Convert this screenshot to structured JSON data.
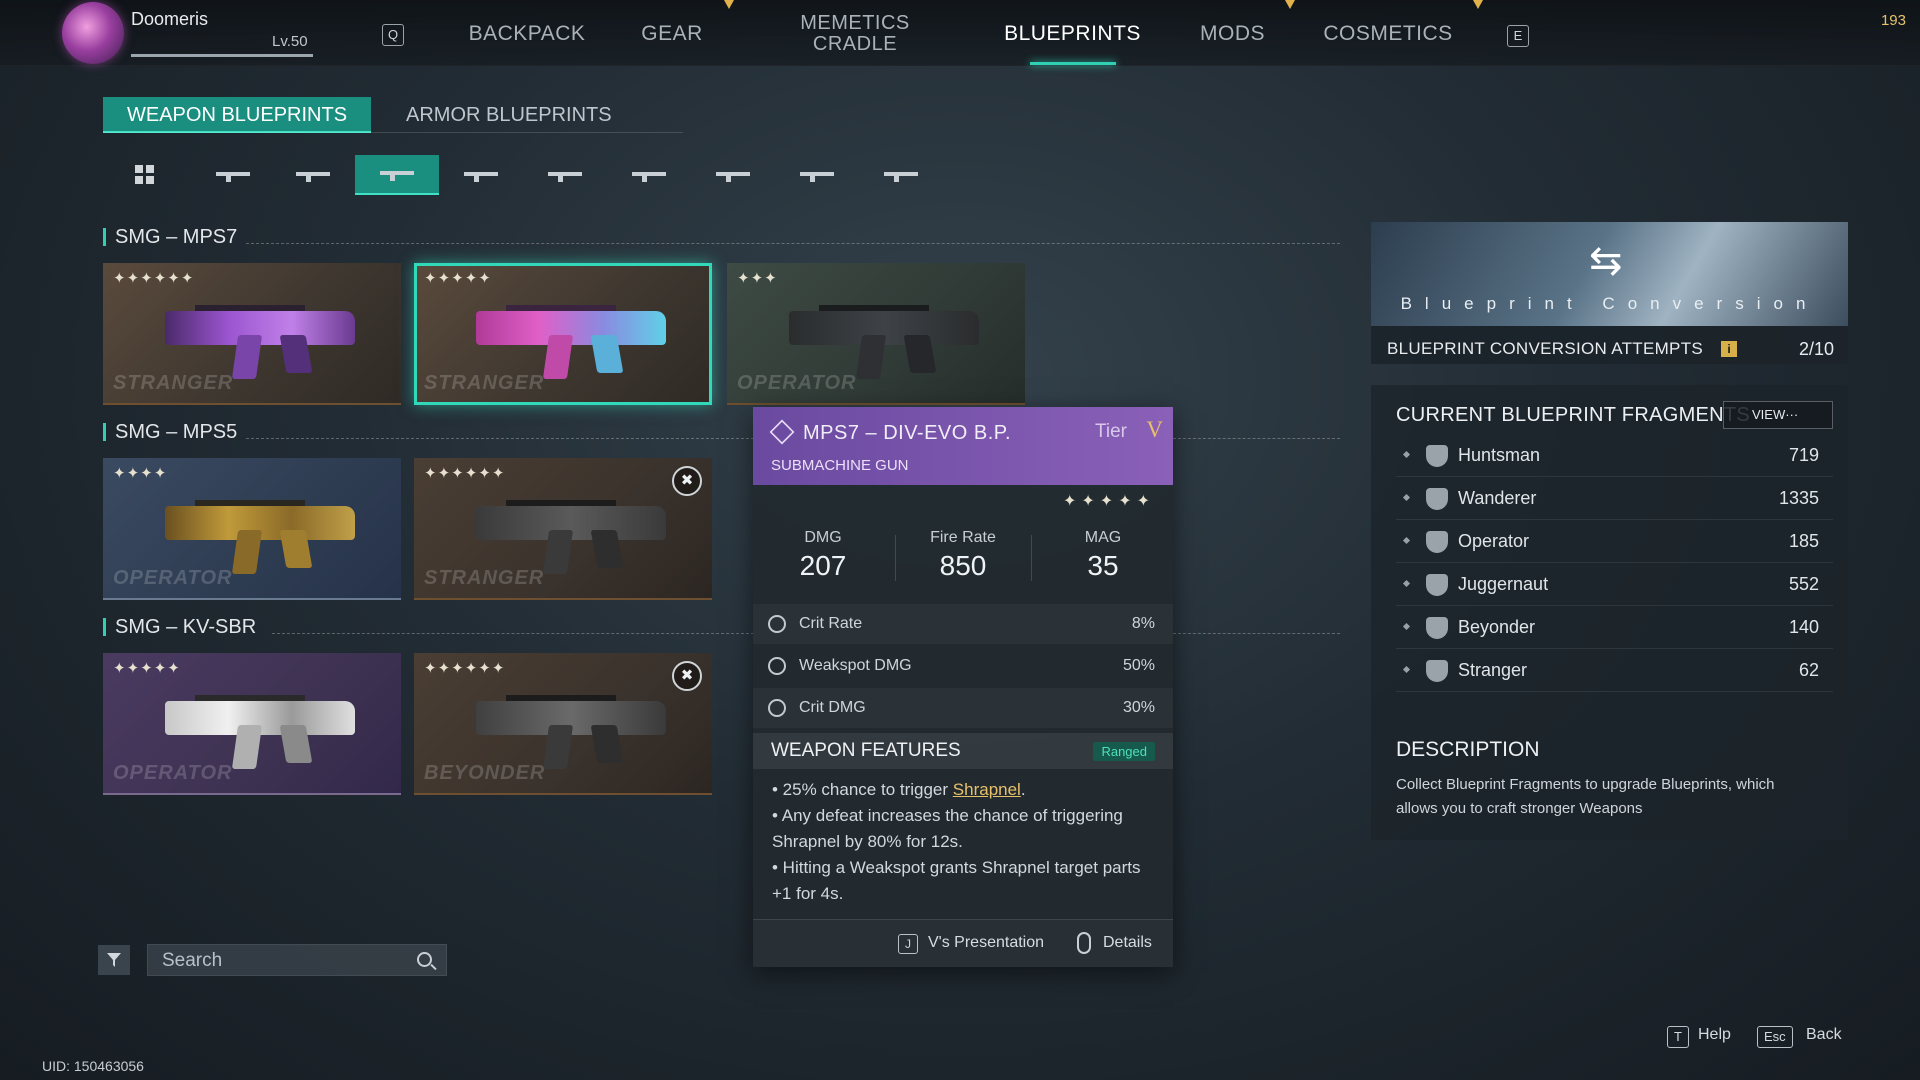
{
  "player": {
    "name": "Doomeris",
    "level": "Lv.50"
  },
  "top_counter": "193",
  "nav": {
    "left_key": "Q",
    "right_key": "E",
    "items": [
      "BACKPACK",
      "GEAR",
      "MEMETICS\nCRADLE",
      "BLUEPRINTS",
      "MODS",
      "COSMETICS"
    ],
    "memetics_line1": "MEMETICS",
    "memetics_line2": "CRADLE",
    "active": "BLUEPRINTS"
  },
  "subtabs": [
    "WEAPON BLUEPRINTS",
    "ARMOR BLUEPRINTS"
  ],
  "sections": [
    {
      "title": "SMG – MPS7",
      "cards": [
        {
          "stars": "✦✦✦✦✦✦",
          "watermark": "STRANGER",
          "theme": "purple"
        },
        {
          "stars": "✦✦✦✦✦",
          "watermark": "STRANGER",
          "theme": "pink",
          "selected": true
        },
        {
          "stars": "✦✦✦",
          "watermark": "OPERATOR",
          "theme": "dark"
        }
      ]
    },
    {
      "title": "SMG – MPS5",
      "cards": [
        {
          "stars": "✦✦✦✦",
          "watermark": "OPERATOR",
          "theme": "gold"
        },
        {
          "stars": "✦✦✦✦✦✦",
          "watermark": "STRANGER",
          "theme": "grey"
        }
      ]
    },
    {
      "title": "SMG – KV-SBR",
      "cards": [
        {
          "stars": "✦✦✦✦✦",
          "watermark": "OPERATOR",
          "theme": "white"
        },
        {
          "stars": "✦✦✦✦✦✦",
          "watermark": "BEYONDER",
          "theme": "dark"
        }
      ]
    }
  ],
  "search": {
    "placeholder": "Search"
  },
  "uid": "UID: 150463056",
  "tooltip": {
    "name": "MPS7 – DIV-EVO B.P.",
    "type": "SUBMACHINE GUN",
    "tier_label": "Tier",
    "tier_value": "V",
    "stars": "✦✦✦✦✦",
    "stats": [
      {
        "label": "DMG",
        "value": "207"
      },
      {
        "label": "Fire Rate",
        "value": "850"
      },
      {
        "label": "MAG",
        "value": "35"
      }
    ],
    "substats": [
      {
        "label": "Crit Rate",
        "value": "8%"
      },
      {
        "label": "Weakspot DMG",
        "value": "50%"
      },
      {
        "label": "Crit DMG",
        "value": "30%"
      }
    ],
    "features_title": "WEAPON FEATURES",
    "features_badge": "Ranged",
    "feature_1_pre": "• 25% chance to trigger ",
    "feature_1_kw": "Shrapnel",
    "feature_1_post": ".",
    "feature_2": "• Any defeat increases the chance of triggering Shrapnel by 80% for 12s.",
    "feature_3": "• Hitting a Weakspot grants Shrapnel target parts +1 for 4s.",
    "footer_key": "J",
    "footer_presentation": "V's Presentation",
    "footer_details": "Details"
  },
  "conversion": {
    "banner_title": "Blueprint Conversion",
    "label": "BLUEPRINT CONVERSION ATTEMPTS",
    "value": "2/10"
  },
  "fragments": {
    "title": "CURRENT BLUEPRINT FRAGMENTS",
    "view_button": "VIEW···",
    "items": [
      {
        "name": "Huntsman",
        "value": "719"
      },
      {
        "name": "Wanderer",
        "value": "1335"
      },
      {
        "name": "Operator",
        "value": "185"
      },
      {
        "name": "Juggernaut",
        "value": "552"
      },
      {
        "name": "Beyonder",
        "value": "140"
      },
      {
        "name": "Stranger",
        "value": "62"
      }
    ],
    "description_title": "DESCRIPTION",
    "description": "Collect Blueprint Fragments to upgrade Blueprints, which allows you to craft stronger Weapons"
  },
  "footer": {
    "help_key": "T",
    "help": "Help",
    "back_key": "Esc",
    "back": "Back"
  },
  "colors": {
    "accent": "#2fd0b4",
    "tier_purple": "#7a55ad",
    "gold": "#e8c06a"
  }
}
